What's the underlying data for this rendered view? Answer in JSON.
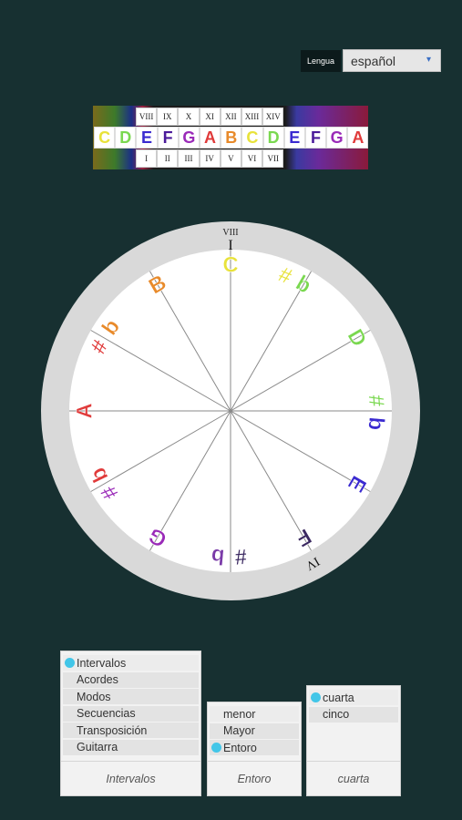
{
  "language": {
    "label": "Lengua",
    "selected": "español"
  },
  "keyboard": {
    "roman_top": [
      "VIII",
      "IX",
      "X",
      "XI",
      "XII",
      "XIII",
      "XIV"
    ],
    "roman_bottom": [
      "I",
      "II",
      "III",
      "IV",
      "V",
      "VI",
      "VII"
    ],
    "notes": [
      {
        "t": "C",
        "c": "#e8e23a"
      },
      {
        "t": "D",
        "c": "#7ad850"
      },
      {
        "t": "E",
        "c": "#3a2ad0"
      },
      {
        "t": "F",
        "c": "#4a1a9a"
      },
      {
        "t": "G",
        "c": "#9a2ab8"
      },
      {
        "t": "A",
        "c": "#e03a3a"
      },
      {
        "t": "B",
        "c": "#e88a2a"
      },
      {
        "t": "C",
        "c": "#e8e23a"
      },
      {
        "t": "D",
        "c": "#7ad850"
      },
      {
        "t": "E",
        "c": "#3a2ad0"
      },
      {
        "t": "F",
        "c": "#4a1a9a"
      },
      {
        "t": "G",
        "c": "#9a2ab8"
      },
      {
        "t": "A",
        "c": "#e03a3a"
      }
    ]
  },
  "wheel": {
    "top_marker": "VIII",
    "top_tick": "I",
    "bottom_marker": "IV",
    "labels": [
      {
        "t": "C",
        "c": "#e8e23a",
        "a": 0
      },
      {
        "t": "#",
        "c": "#e8e23a",
        "a": 22
      },
      {
        "t": "b",
        "c": "#7ad850",
        "a": 30
      },
      {
        "t": "D",
        "c": "#7ad850",
        "a": 60
      },
      {
        "t": "#",
        "c": "#7ad850",
        "a": 86
      },
      {
        "t": "b",
        "c": "#3a2ad0",
        "a": 95
      },
      {
        "t": "E",
        "c": "#3a2ad0",
        "a": 120
      },
      {
        "t": "F",
        "c": "#3a2860",
        "a": 150
      },
      {
        "t": "#",
        "c": "#3a2860",
        "a": 176
      },
      {
        "t": "b",
        "c": "#7a3aa8",
        "a": 185
      },
      {
        "t": "G",
        "c": "#9a2ab8",
        "a": 210
      },
      {
        "t": "#",
        "c": "#9a2ab8",
        "a": 236
      },
      {
        "t": "b",
        "c": "#e03a3a",
        "a": 244
      },
      {
        "t": "A",
        "c": "#e03a3a",
        "a": 270
      },
      {
        "t": "#",
        "c": "#e03a3a",
        "a": 296
      },
      {
        "t": "b",
        "c": "#e88a2a",
        "a": 305
      },
      {
        "t": "B",
        "c": "#e88a2a",
        "a": 330
      }
    ]
  },
  "panels": {
    "left": {
      "items": [
        "Intervalos",
        "Acordes",
        "Modos",
        "Secuencias",
        "Transposición",
        "Guitarra"
      ],
      "selected": 0,
      "footer": "Intervalos"
    },
    "middle": {
      "items": [
        "menor",
        "Mayor",
        "Entoro"
      ],
      "selected": 2,
      "footer": "Entoro"
    },
    "right": {
      "items": [
        "cuarta",
        "cinco"
      ],
      "selected": 0,
      "footer": "cuarta"
    }
  },
  "colors": {
    "background": "#173031",
    "selected_dot": "#42c6e8"
  }
}
